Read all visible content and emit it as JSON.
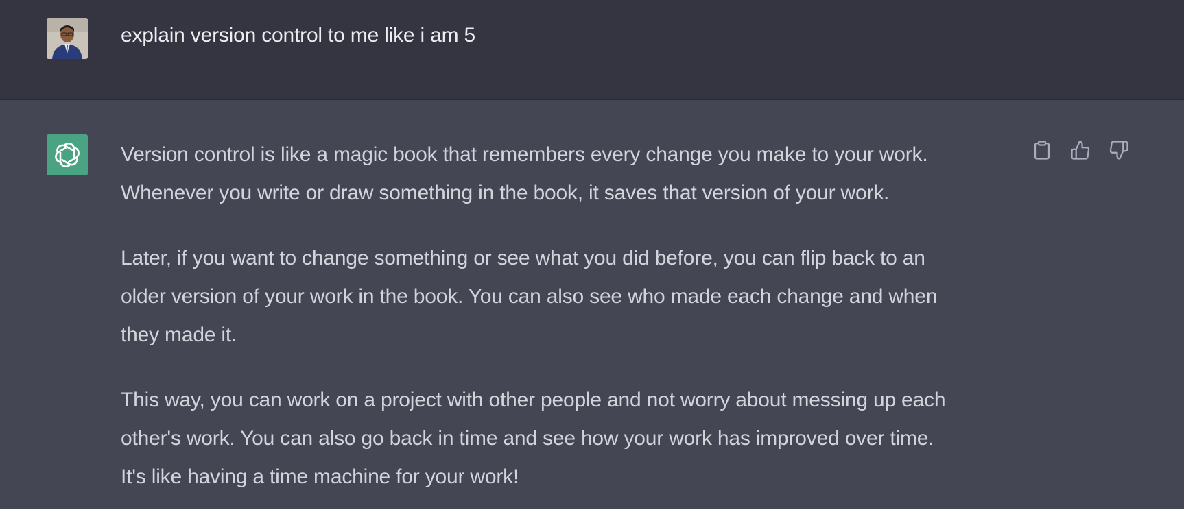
{
  "user_message": {
    "text": "explain version control to me like i am 5"
  },
  "assistant_message": {
    "paragraphs": [
      "Version control is like a magic book that remembers every change you make to your work.\nWhenever you write or draw something in the book, it saves that version of your work.",
      "Later, if you want to change something or see what you did before, you can flip back to an\nolder version of your work in the book. You can also see who made each change and when\nthey made it.",
      "This way, you can work on a project with other people and not worry about messing up each\nother's work. You can also go back in time and see how your work has improved over time.\nIt's like having a time machine for your work!"
    ]
  },
  "actions": {
    "copy": "clipboard-icon",
    "like": "thumbs-up-icon",
    "dislike": "thumbs-down-icon"
  },
  "colors": {
    "user_bg": "#343541",
    "assistant_bg": "#444654",
    "bot_avatar": "#4aa383",
    "text_primary": "#ececf1",
    "text_secondary": "#d1d5db"
  }
}
